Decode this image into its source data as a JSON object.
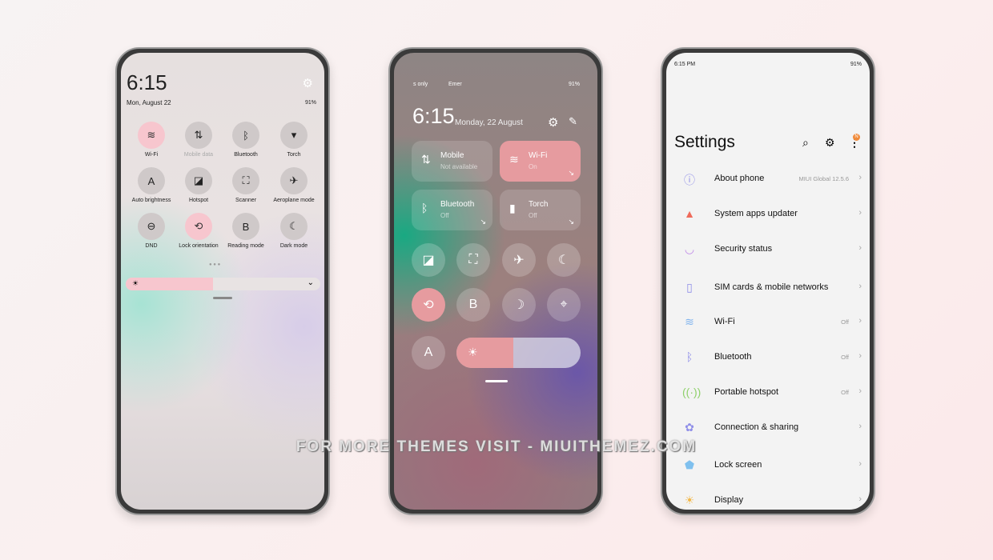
{
  "phone1": {
    "time": "6:15",
    "date": "Mon, August 22",
    "battery": "91%",
    "tiles": [
      {
        "label": "Wi-Fi",
        "icon": "wifi-icon",
        "glyph": "≋",
        "on": true
      },
      {
        "label": "Mobile data",
        "icon": "mobile-data-icon",
        "glyph": "⇅",
        "on": false,
        "dim": true
      },
      {
        "label": "Bluetooth",
        "icon": "bluetooth-icon",
        "glyph": "ᛒ",
        "on": false
      },
      {
        "label": "Torch",
        "icon": "torch-icon",
        "glyph": "▾",
        "on": false
      },
      {
        "label": "Auto brightness",
        "icon": "auto-brightness-icon",
        "glyph": "A",
        "on": false
      },
      {
        "label": "Hotspot",
        "icon": "hotspot-icon",
        "glyph": "◪",
        "on": false
      },
      {
        "label": "Scanner",
        "icon": "scanner-icon",
        "glyph": "⛶",
        "on": false
      },
      {
        "label": "Aeroplane mode",
        "icon": "airplane-icon",
        "glyph": "✈",
        "on": false
      },
      {
        "label": "DND",
        "icon": "dnd-icon",
        "glyph": "⊖",
        "on": false
      },
      {
        "label": "Lock orientation",
        "icon": "lock-orientation-icon",
        "glyph": "⟲",
        "on": true
      },
      {
        "label": "Reading mode",
        "icon": "reading-mode-icon",
        "glyph": "B",
        "on": false
      },
      {
        "label": "Dark mode",
        "icon": "dark-mode-icon",
        "glyph": "☾",
        "on": false
      }
    ],
    "brightness": 0.45
  },
  "phone2": {
    "status_left": "s only",
    "status_mid": "Emer",
    "battery": "91%",
    "time": "6:15",
    "date": "Monday, 22 August",
    "cards": [
      {
        "title": "Mobile",
        "sub": "Not available",
        "icon": "mobile-data-icon",
        "glyph": "⇅",
        "on": false
      },
      {
        "title": "Wi-Fi",
        "sub": "On",
        "icon": "wifi-icon",
        "glyph": "≋",
        "on": true
      },
      {
        "title": "Bluetooth",
        "sub": "Off",
        "icon": "bluetooth-icon",
        "glyph": "ᛒ",
        "on": false
      },
      {
        "title": "Torch",
        "sub": "Off",
        "icon": "torch-icon",
        "glyph": "▮",
        "on": false
      }
    ],
    "buttons": [
      {
        "icon": "hotspot-icon",
        "glyph": "◪",
        "on": false
      },
      {
        "icon": "scanner-icon",
        "glyph": "⛶",
        "on": false
      },
      {
        "icon": "airplane-icon",
        "glyph": "✈",
        "on": false
      },
      {
        "icon": "dark-mode-icon",
        "glyph": "☾",
        "on": false
      },
      {
        "icon": "lock-orientation-icon",
        "glyph": "⟲",
        "on": true
      },
      {
        "icon": "reading-mode-icon",
        "glyph": "B",
        "on": false
      },
      {
        "icon": "moon-icon",
        "glyph": "☽",
        "on": false
      },
      {
        "icon": "location-icon",
        "glyph": "⌖",
        "on": false
      }
    ],
    "auto_label": "A",
    "brightness": 0.46
  },
  "phone3": {
    "time": "6:15 PM",
    "battery": "91%",
    "title": "Settings",
    "badge": "N",
    "items": [
      {
        "label": "About phone",
        "value": "MIUI Global 12.5.6",
        "icon": "info-icon",
        "glyph": "ⓘ",
        "color": "#8f8ee8"
      },
      {
        "label": "System apps updater",
        "value": "",
        "icon": "warning-icon",
        "glyph": "▲",
        "color": "#ef6a5a"
      },
      {
        "label": "Security status",
        "value": "",
        "icon": "shield-icon",
        "glyph": "◡",
        "color": "#c08ae8"
      },
      {
        "label": "SIM cards & mobile networks",
        "value": "",
        "icon": "sim-icon",
        "glyph": "▯",
        "color": "#8f8ee8"
      },
      {
        "label": "Wi-Fi",
        "value": "Off",
        "icon": "wifi-icon",
        "glyph": "≋",
        "color": "#7fb3ee"
      },
      {
        "label": "Bluetooth",
        "value": "Off",
        "icon": "bluetooth-icon",
        "glyph": "ᛒ",
        "color": "#8f8ee8"
      },
      {
        "label": "Portable hotspot",
        "value": "Off",
        "icon": "hotspot-icon",
        "glyph": "((·))",
        "color": "#8ed06a"
      },
      {
        "label": "Connection & sharing",
        "value": "",
        "icon": "connection-icon",
        "glyph": "✿",
        "color": "#8f8ee8"
      },
      {
        "label": "Lock screen",
        "value": "",
        "icon": "lock-screen-icon",
        "glyph": "⬟",
        "color": "#7fc0ee"
      },
      {
        "label": "Display",
        "value": "",
        "icon": "display-icon",
        "glyph": "☀",
        "color": "#f2b84a"
      }
    ]
  },
  "watermark": "FOR MORE THEMES VISIT - MIUITHEMEZ.COM"
}
